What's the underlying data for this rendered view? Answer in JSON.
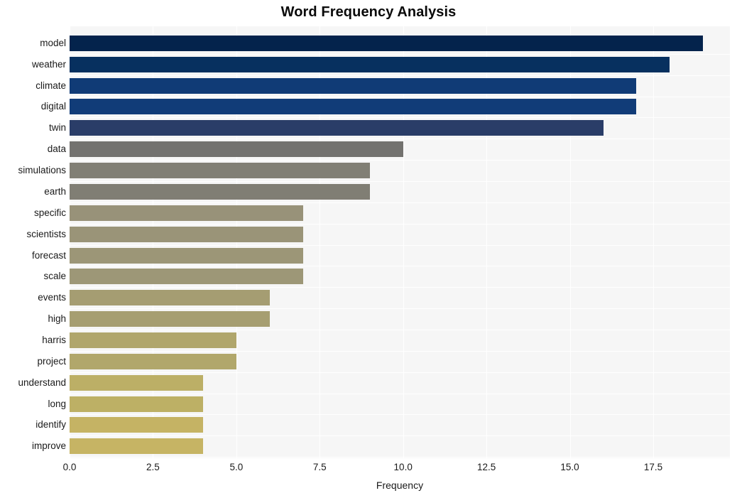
{
  "chart_data": {
    "type": "bar",
    "orientation": "horizontal",
    "title": "Word Frequency Analysis",
    "xlabel": "Frequency",
    "ylabel": "",
    "xlim": [
      0,
      19.8
    ],
    "xticks": [
      0.0,
      2.5,
      5.0,
      7.5,
      10.0,
      12.5,
      15.0,
      17.5
    ],
    "xtick_labels": [
      "0.0",
      "2.5",
      "5.0",
      "7.5",
      "10.0",
      "12.5",
      "15.0",
      "17.5"
    ],
    "grid": true,
    "legend": null,
    "categories": [
      "model",
      "weather",
      "climate",
      "digital",
      "twin",
      "data",
      "simulations",
      "earth",
      "specific",
      "scientists",
      "forecast",
      "scale",
      "events",
      "high",
      "harris",
      "project",
      "understand",
      "long",
      "identify",
      "improve"
    ],
    "values": [
      19,
      18,
      17,
      17,
      16,
      10,
      9,
      9,
      7,
      7,
      7,
      7,
      6,
      6,
      5,
      5,
      4,
      4,
      4,
      4
    ],
    "bar_colors": [
      "#04234c",
      "#07305f",
      "#103b76",
      "#113c78",
      "#2a3d68",
      "#73726f",
      "#817f75",
      "#807e74",
      "#989279",
      "#9a9478",
      "#9c9677",
      "#9d9777",
      "#a59d72",
      "#a69e71",
      "#b0a66c",
      "#b1a76b",
      "#bcaf66",
      "#bdb065",
      "#c5b364",
      "#c6b464"
    ],
    "plot_bg": "#f6f6f6",
    "figure_bg": "#ffffff"
  }
}
